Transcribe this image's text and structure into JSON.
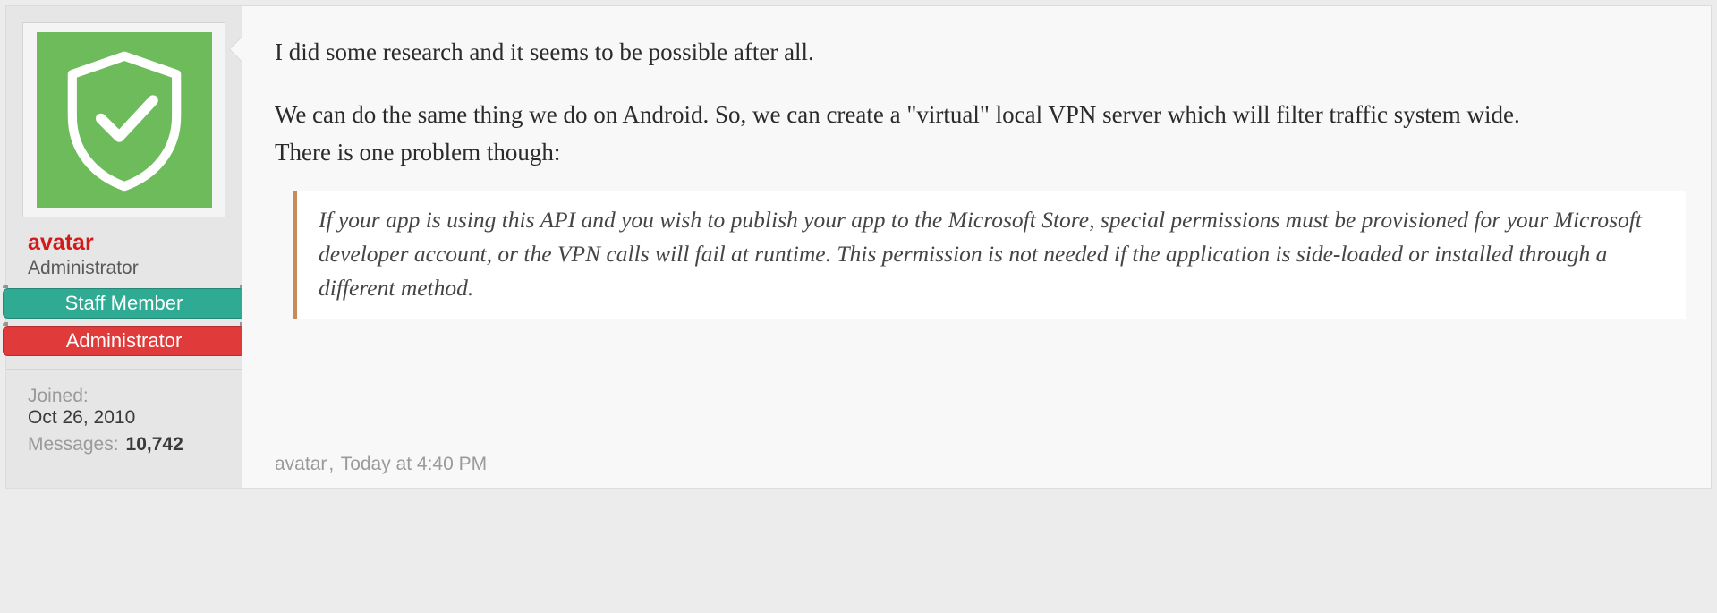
{
  "user": {
    "name": "avatar",
    "title": "Administrator",
    "badges": [
      "Staff Member",
      "Administrator"
    ],
    "joined_label": "Joined:",
    "joined_value": "Oct 26, 2010",
    "messages_label": "Messages:",
    "messages_value": "10,742",
    "avatar_icon": "shield-check"
  },
  "post": {
    "paragraphs": [
      "I did some research and it seems to be possible after all.",
      "We can do the same thing we do on Android. So, we can create a \"virtual\" local VPN server which will filter traffic system wide.",
      "There is one problem though:"
    ],
    "quote": "If your app is using this API and you wish to publish your app to the Microsoft Store, special permissions must be provisioned for your Microsoft developer account, or the VPN calls will fail at runtime. This permission is not needed if the application is side-loaded or installed through a different method."
  },
  "footer": {
    "author": "avatar",
    "timestamp": "Today at 4:40 PM"
  }
}
